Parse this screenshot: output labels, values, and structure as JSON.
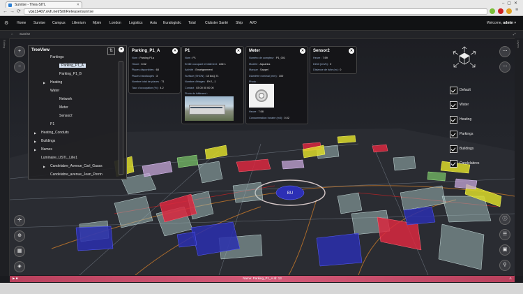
{
  "browser": {
    "tab_title": "Sunrise - Thea-SITL",
    "url_host": "vps11407.ovh.net",
    "url_path": "/Sitl/Release/sunrise"
  },
  "menu": {
    "items": [
      "Home",
      "Sunrise",
      "Campus",
      "Lilienium",
      "Mpim",
      "London",
      "Logistics",
      "Asia",
      "Euralogistic",
      "Total",
      "Clubster Santé",
      "Ship",
      "AVD"
    ],
    "welcome_prefix": "Welcome,",
    "welcome_user": "admin"
  },
  "subbar": {
    "label": "Sunrise"
  },
  "side_labels": {
    "left": "Editing",
    "right": "Layers"
  },
  "treeview": {
    "title": "TreeView",
    "items": [
      {
        "label": "Parkings",
        "indent": 2,
        "arrow": false,
        "selected": false
      },
      {
        "label": "Parking_P1_A",
        "indent": 3,
        "arrow": false,
        "selected": true
      },
      {
        "label": "Parking_P1_B",
        "indent": 3,
        "arrow": false,
        "selected": false
      },
      {
        "label": "Heating",
        "indent": 2,
        "arrow": true,
        "selected": false
      },
      {
        "label": "Water",
        "indent": 2,
        "arrow": false,
        "selected": false
      },
      {
        "label": "Network",
        "indent": 3,
        "arrow": false,
        "selected": false
      },
      {
        "label": "Meter",
        "indent": 3,
        "arrow": false,
        "selected": false
      },
      {
        "label": "Sensor2",
        "indent": 3,
        "arrow": false,
        "selected": false
      },
      {
        "label": "P1",
        "indent": 2,
        "arrow": false,
        "selected": false
      },
      {
        "label": "Heating_Conduits",
        "indent": 1,
        "arrow": true,
        "selected": false
      },
      {
        "label": "Buildings",
        "indent": 1,
        "arrow": true,
        "selected": false
      },
      {
        "label": "Names",
        "indent": 1,
        "arrow": true,
        "selected": false
      },
      {
        "label": "Luminaire_USTL_Lille1",
        "indent": 1,
        "arrow": false,
        "selected": false
      },
      {
        "label": "Candelabre_Avenue_Carl_Gauss",
        "indent": 2,
        "arrow": true,
        "selected": false
      },
      {
        "label": "Candelabre_avenue_Jean_Perrin",
        "indent": 2,
        "arrow": false,
        "selected": false
      }
    ]
  },
  "panels": {
    "parking": {
      "title": "Parking_P1_A",
      "rows": [
        {
          "k": "Nom :",
          "v": "Parking P1a"
        },
        {
          "k": "Heure :",
          "v": "6:52"
        },
        {
          "k": "Places disponibles :",
          "v": "68"
        },
        {
          "k": "Places handicapés :",
          "v": "3"
        },
        {
          "k": "Nombre total de places :",
          "v": "71"
        },
        {
          "k": "Taux d'occupation (%) :",
          "v": "4.2"
        }
      ]
    },
    "p1": {
      "title": "P1",
      "rows": [
        {
          "k": "Nom :",
          "v": "P1"
        },
        {
          "k": "Entité occupant le bâtiment :",
          "v": "Lille 1"
        },
        {
          "k": "Activité :",
          "v": "Enseignement"
        },
        {
          "k": "Surface (SHON) :",
          "v": "10 8oQ,71"
        },
        {
          "k": "Nombre d'étages :",
          "v": "R+2, -1"
        },
        {
          "k": "Contact :",
          "v": "03 00 00 00 00"
        },
        {
          "k": "Photo du bâtiment :",
          "v": ""
        }
      ]
    },
    "meter": {
      "title": "Meter",
      "rows": [
        {
          "k": "Numéro de compteur :",
          "v": "P1_001"
        },
        {
          "k": "Modèle :",
          "v": "Aquarius"
        },
        {
          "k": "Marque :",
          "v": "Sappel"
        },
        {
          "k": "Diamètre nominal (mm) :",
          "v": "100"
        },
        {
          "k": "Photo :",
          "v": ""
        }
      ],
      "rows_after": [
        {
          "k": "Heure :",
          "v": "7:58"
        },
        {
          "k": "Consommation horaire (m3) :",
          "v": "0.02"
        }
      ]
    },
    "sensor": {
      "title": "Sensor2",
      "rows": [
        {
          "k": "Heure :",
          "v": "7:59"
        },
        {
          "k": "Débit (m3/h) :",
          "v": "0"
        },
        {
          "k": "Distance de fuite (m) :",
          "v": "0"
        }
      ]
    }
  },
  "legend": [
    "Default",
    "Water",
    "Heating",
    "Parkings",
    "Buildings",
    "Candelabres"
  ],
  "map": {
    "roundabout_label": "BU"
  },
  "status": {
    "text": "Name: Parking_P1_A Id: 13"
  },
  "colors": {
    "accent_status": "#c84b6a",
    "parking_red": "#d9283f",
    "building_blue": "#2a2fae",
    "yellow": "#dada2a",
    "ghost": "#a8c2c0"
  }
}
